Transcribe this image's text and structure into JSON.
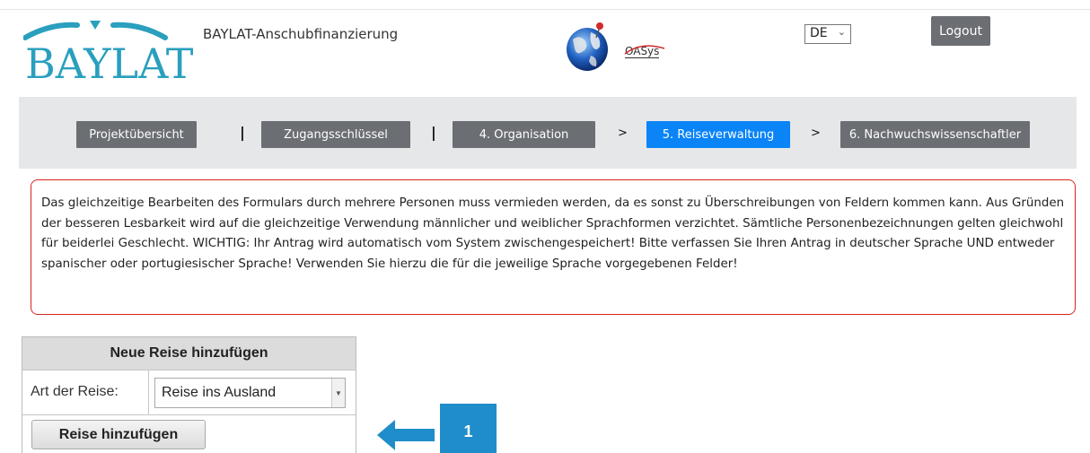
{
  "brand": {
    "logo_text": "BAYLAT",
    "app_title": "BAYLAT-Anschubfinanzierung",
    "partner_logo_text": "OASys",
    "brand_color": "#2a9fbe"
  },
  "header": {
    "language_selected": "DE",
    "logout_label": "Logout"
  },
  "nav": {
    "items": [
      {
        "label": "Projektübersicht",
        "state": "default"
      },
      {
        "label": "Zugangsschlüssel",
        "state": "default"
      },
      {
        "label": "4. Organisation",
        "state": "default"
      },
      {
        "label": "5. Reiseverwaltung",
        "state": "active"
      },
      {
        "label": "6. Nachwuchswissenschaftler",
        "state": "default"
      }
    ],
    "separators": [
      "|",
      "|",
      ">",
      ">"
    ],
    "active_color": "#0a84f7",
    "default_color": "#6b6e73"
  },
  "notice": {
    "text": "Das gleichzeitige Bearbeiten des Formulars durch mehrere Personen muss vermieden werden, da es sonst zu Überschreibungen von Feldern kommen kann. Aus Gründen der besseren Lesbarkeit wird auf die gleichzeitige Verwendung männlicher und weiblicher Sprachformen verzichtet. Sämtliche Personenbezeichnungen gelten gleichwohl für beiderlei Geschlecht. WICHTIG: Ihr Antrag wird automatisch vom System zwischengespeichert! Bitte verfassen Sie Ihren Antrag in deutscher Sprache UND entweder spanischer oder portugiesischer Sprache! Verwenden Sie hierzu die für die jeweilige Sprache vorgegebenen Felder!",
    "border_color": "#d9231f"
  },
  "trip_form": {
    "header": "Neue Reise hinzufügen",
    "type_label": "Art der Reise:",
    "type_value": "Reise ins Ausland",
    "add_button_label": "Reise hinzufügen"
  },
  "annotation": {
    "step_number": "1",
    "color": "#1f8dc9"
  }
}
